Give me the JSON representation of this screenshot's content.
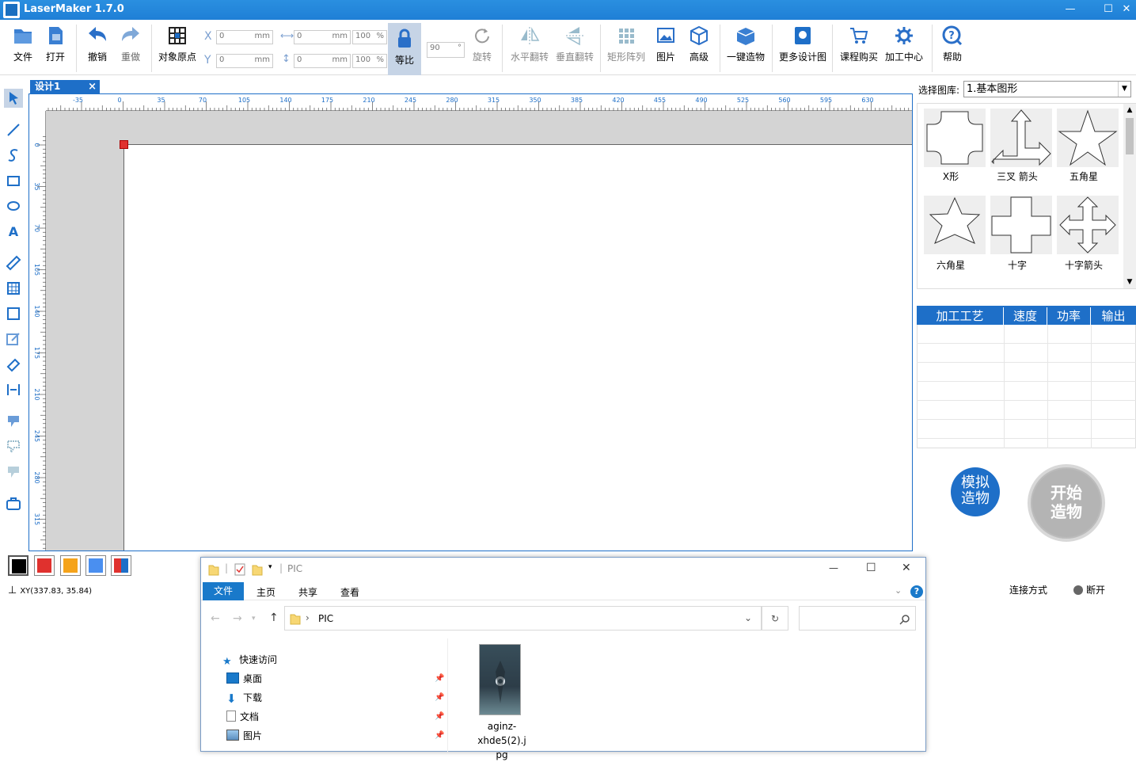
{
  "app": {
    "title": "LaserMaker 1.7.0"
  },
  "toolbar": {
    "file": "文件",
    "open": "打开",
    "undo": "撤销",
    "redo": "重做",
    "origin": "对象原点",
    "x_label": "X",
    "y_label": "Y",
    "x_value": "0",
    "y_value": "0",
    "w_value": "0",
    "h_value": "0",
    "w_pct": "100",
    "h_pct": "100",
    "unit_mm": "mm",
    "unit_pct": "%",
    "lock": "等比",
    "angle": "90",
    "angle_unit": "°",
    "rotate": "旋转",
    "hflip": "水平翻转",
    "vflip": "垂直翻转",
    "array": "矩形阵列",
    "image": "图片",
    "advanced": "高级",
    "oneclick": "一键造物",
    "more": "更多设计图",
    "course": "课程购买",
    "center": "加工中心",
    "help": "帮助"
  },
  "document": {
    "tab_label": "设计1",
    "tab_close": "×"
  },
  "rulers": {
    "h_ticks": [
      "-35",
      "0",
      "35",
      "70",
      "105",
      "140",
      "175",
      "210",
      "245",
      "280",
      "315",
      "350",
      "385",
      "420",
      "455",
      "490",
      "525",
      "560",
      "595",
      "630"
    ],
    "v_ticks": [
      "0",
      "35",
      "70",
      "105",
      "140",
      "175",
      "210",
      "245",
      "280",
      "315"
    ]
  },
  "library": {
    "label": "选择图库:",
    "selected": "1.基本图形",
    "shapes": [
      {
        "name": "X形",
        "icon": "x-shape-icon"
      },
      {
        "name": "三叉 箭头",
        "icon": "trident-arrow-icon"
      },
      {
        "name": "五角星",
        "icon": "five-star-icon"
      },
      {
        "name": "六角星",
        "icon": "six-star-icon"
      },
      {
        "name": "十字",
        "icon": "cross-icon"
      },
      {
        "name": "十字箭头",
        "icon": "cross-arrow-icon"
      }
    ]
  },
  "process": {
    "columns": [
      "加工工艺",
      "速度",
      "功率",
      "输出"
    ]
  },
  "buttons": {
    "simulate_l1": "模拟",
    "simulate_l2": "造物",
    "start_l1": "开始",
    "start_l2": "造物"
  },
  "colors": {
    "swatches": [
      "#000000",
      "#e0312e",
      "#f5a31a",
      "#4a8ff0"
    ],
    "accent": "#1e6fc8"
  },
  "status": {
    "coords": "XY(337.83, 35.84)",
    "connection_label": "连接方式",
    "disconnect": "断开"
  },
  "explorer": {
    "title": "PIC",
    "ribbon_tabs": [
      "文件",
      "主页",
      "共享",
      "查看"
    ],
    "address": "PIC",
    "nav": [
      {
        "label": "快速访问",
        "icon": "star-icon"
      },
      {
        "label": "桌面",
        "icon": "desktop-icon"
      },
      {
        "label": "下载",
        "icon": "download-icon"
      },
      {
        "label": "文档",
        "icon": "document-icon"
      },
      {
        "label": "图片",
        "icon": "pictures-icon"
      }
    ],
    "file": {
      "name_l1": "aginz-xhde5(2).j",
      "name_l2": "pg"
    }
  }
}
